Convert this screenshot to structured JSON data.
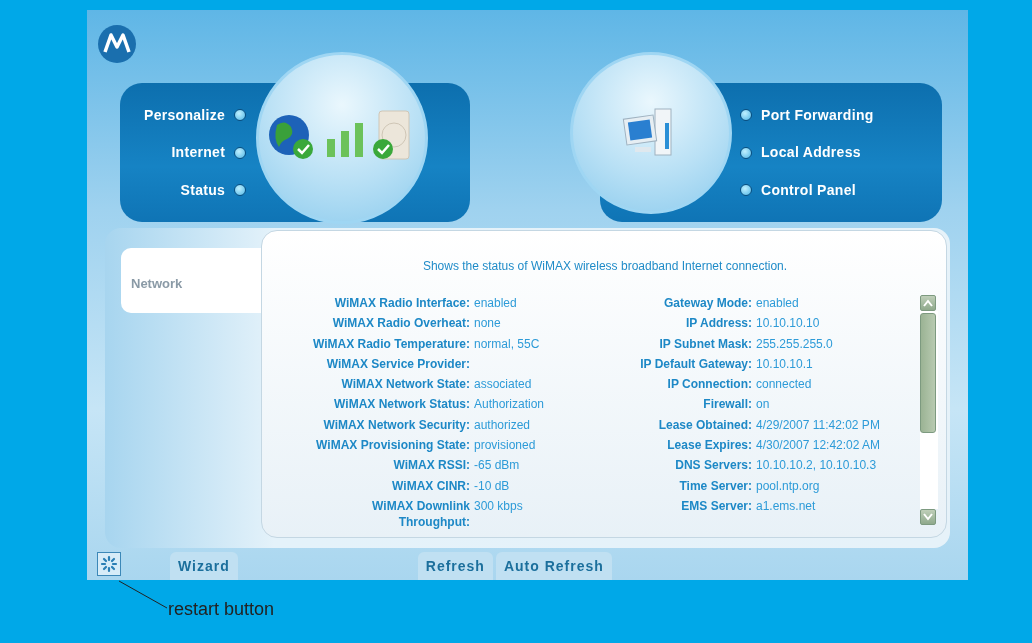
{
  "nav_left": [
    {
      "label": "Personalize"
    },
    {
      "label": "Internet"
    },
    {
      "label": "Status"
    }
  ],
  "nav_right": [
    {
      "label": "Port Forwarding"
    },
    {
      "label": "Local Address"
    },
    {
      "label": "Control Panel"
    }
  ],
  "sidebar": {
    "items": [
      {
        "label": "Network",
        "selected": true
      }
    ]
  },
  "content": {
    "description": "Shows the status of WiMAX wireless broadband Internet connection.",
    "left_fields": [
      {
        "label": "WiMAX Radio Interface:",
        "value": "enabled"
      },
      {
        "label": "WiMAX Radio Overheat:",
        "value": "none"
      },
      {
        "label": "WiMAX Radio Temperature:",
        "value": "normal, 55C"
      },
      {
        "label": "WiMAX Service Provider:"
      },
      {
        "label": "WiMAX Network State:",
        "value": "associated"
      },
      {
        "label": "WiMAX Network Status:",
        "value": "Authorization"
      },
      {
        "label": "WiMAX Network Security:",
        "value": "authorized"
      },
      {
        "label": "WiMAX Provisioning State:",
        "value": "provisioned"
      },
      {
        "label": "WiMAX RSSI:",
        "value": "-65 dBm"
      },
      {
        "label": "WiMAX CINR:",
        "value": "-10 dB"
      },
      {
        "label": "WiMAX Downlink Throughput:",
        "value": "300 kbps"
      }
    ],
    "right_fields": [
      {
        "label": "Gateway Mode:",
        "value": "enabled"
      },
      {
        "label": "IP Address:",
        "value": "10.10.10.10"
      },
      {
        "label": "IP Subnet Mask:",
        "value": "255.255.255.0"
      },
      {
        "label": "IP Default Gateway:",
        "value": "10.10.10.1"
      },
      {
        "label": "IP Connection:",
        "value": "connected"
      },
      {
        "label": "Firewall:",
        "value": "on"
      },
      {
        "label": "Lease Obtained:",
        "value": "4/29/2007 11:42:02 PM"
      },
      {
        "label": "Lease Expires:",
        "value": "4/30/2007 12:42:02 AM"
      },
      {
        "label": "DNS Servers:",
        "value": "10.10.10.2, 10.10.10.3"
      },
      {
        "label": "Time Server:",
        "value": "pool.ntp.org"
      },
      {
        "label": "EMS Server:",
        "value": "a1.ems.net"
      }
    ]
  },
  "footer": {
    "left_buttons": [
      "Wizard"
    ],
    "right_buttons": [
      "Refresh",
      "Auto Refresh"
    ]
  },
  "annotation": {
    "text": "restart button"
  }
}
